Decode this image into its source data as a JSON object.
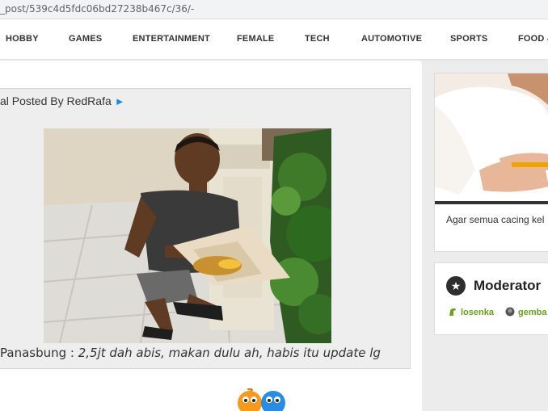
{
  "browser": {
    "url": "_post/539c4d5fdc06bd27238b467c/36/-"
  },
  "nav": {
    "items": [
      "HOBBY",
      "GAMES",
      "ENTERTAINMENT",
      "FEMALE",
      "TECH",
      "AUTOMOTIVE",
      "SPORTS",
      "FOOD &"
    ]
  },
  "post": {
    "posted_prefix": "al Posted By ",
    "author": "RedRafa",
    "arrow": "►",
    "caption_user": "Panasbung : ",
    "caption_text": "2,5jt dah abis, makan dulu ah, habis itu update lg"
  },
  "sidebar": {
    "card_title": "Agar semua cacing kel",
    "moderator": {
      "heading": "Moderator",
      "icon": "star-icon",
      "users": [
        "losenka",
        "gemba"
      ]
    }
  },
  "colors": {
    "accent_arrow": "#1e88e5",
    "moderator_link": "#6aa121",
    "sidebar_bg": "#ececec",
    "post_bg": "#eeeeee"
  }
}
